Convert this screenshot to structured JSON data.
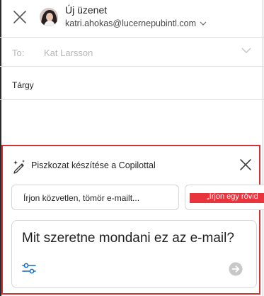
{
  "header": {
    "title": "Új üzenet",
    "from_address": "katri.ahokas@lucernepubintl.com"
  },
  "recipients": {
    "to_label": "To:",
    "to_value": "Kat Larsson"
  },
  "subject": {
    "label": "Tárgy"
  },
  "copilot": {
    "title": "Piszkozat készítése a Copilottal",
    "suggestions": [
      "Írjon közvetlen, tömör e-mailt...",
      "„Írjon egy rövid"
    ],
    "prompt_placeholder": "Mit szeretne mondani ez az e-mail?",
    "highlight_color": "#d13438",
    "accent_color": "#0f6cbd"
  }
}
